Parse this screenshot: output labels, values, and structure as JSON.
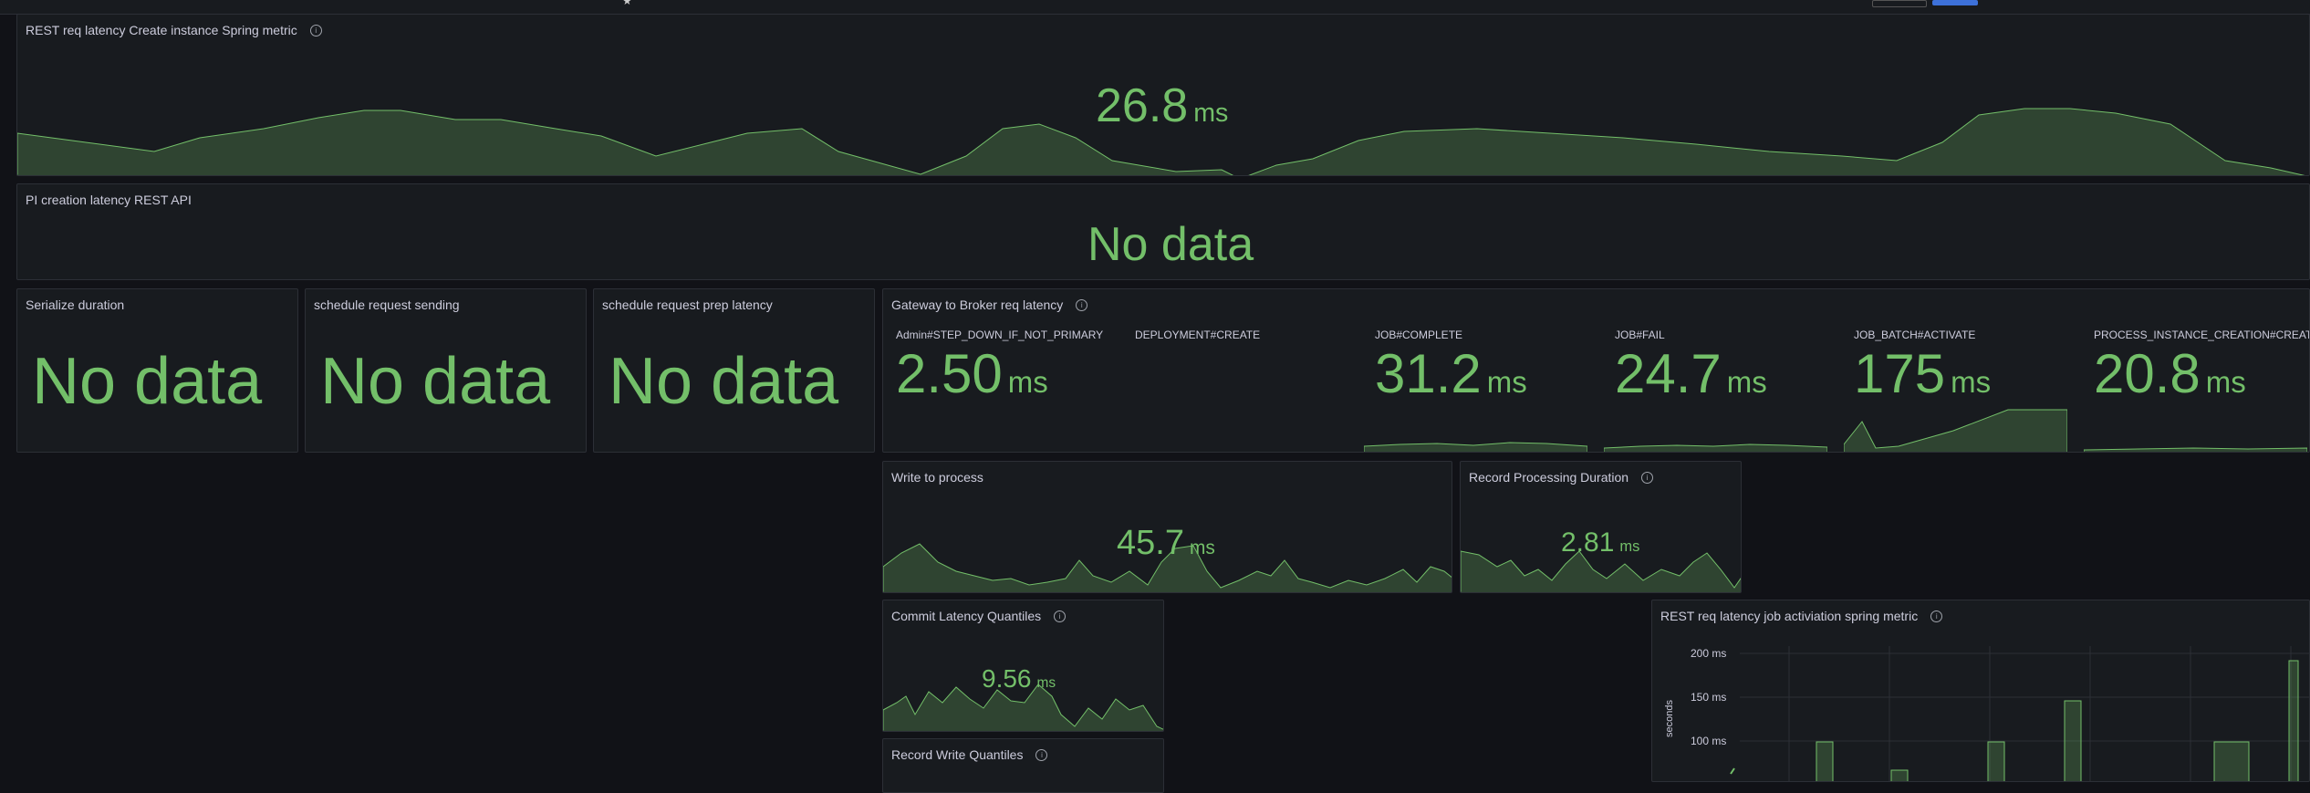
{
  "colors": {
    "value": "#73bf69",
    "fill": "#73bf6940",
    "panel_bg": "#181b1f",
    "page_bg": "#111217",
    "border": "#2c2f36",
    "accent": "#3d71d9"
  },
  "panels": {
    "rest_create": {
      "title": "REST req latency Create instance Spring metric",
      "value": "26.8",
      "unit": "ms"
    },
    "pi_creation": {
      "title": "PI creation latency REST API",
      "value": "No data"
    },
    "serialize": {
      "title": "Serialize duration",
      "value": "No data"
    },
    "schedule_send": {
      "title": "schedule request sending",
      "value": "No data"
    },
    "schedule_prep": {
      "title": "schedule request prep latency",
      "value": "No data"
    },
    "gateway": {
      "title": "Gateway to Broker req latency",
      "items": [
        {
          "label": "Admin#STEP_DOWN_IF_NOT_PRIMARY",
          "value": "2.50",
          "unit": "ms"
        },
        {
          "label": "DEPLOYMENT#CREATE",
          "value": "",
          "unit": ""
        },
        {
          "label": "JOB#COMPLETE",
          "value": "31.2",
          "unit": "ms"
        },
        {
          "label": "JOB#FAIL",
          "value": "24.7",
          "unit": "ms"
        },
        {
          "label": "JOB_BATCH#ACTIVATE",
          "value": "175",
          "unit": "ms"
        },
        {
          "label": "PROCESS_INSTANCE_CREATION#CREATE",
          "value": "20.8",
          "unit": "ms"
        }
      ]
    },
    "write_process": {
      "title": "Write to process",
      "value": "45.7",
      "unit": "ms"
    },
    "record_processing": {
      "title": "Record Processing Duration",
      "value": "2.81",
      "unit": "ms"
    },
    "commit_latency": {
      "title": "Commit Latency Quantiles",
      "value": "9.56",
      "unit": "ms"
    },
    "record_write": {
      "title": "Record Write Quantiles"
    },
    "rest_job_activation": {
      "title": "REST req latency job activiation spring metric",
      "y_axis_label": "seconds",
      "y_ticks": [
        "200 ms",
        "150 ms",
        "100 ms"
      ]
    }
  }
}
